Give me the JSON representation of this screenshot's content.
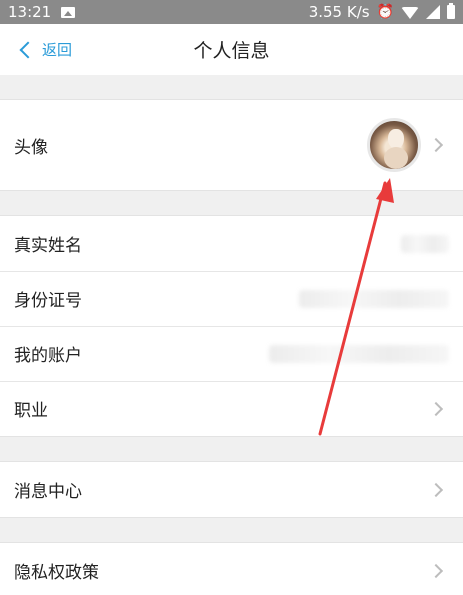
{
  "status_bar": {
    "time": "13:21",
    "network_speed": "3.55 K/s",
    "icons": [
      "image-icon",
      "alarm-icon",
      "wifi-icon",
      "signal-icon",
      "battery-icon"
    ]
  },
  "nav": {
    "back_label": "返回",
    "title": "个人信息"
  },
  "rows": {
    "avatar_label": "头像",
    "real_name_label": "真实姓名",
    "id_number_label": "身份证号",
    "account_label": "我的账户",
    "occupation_label": "职业",
    "message_center_label": "消息中心",
    "privacy_policy_label": "隐私权政策"
  },
  "colors": {
    "accent": "#2a9bd8",
    "annotation_arrow": "#e83b3b",
    "background": "#f0f0f0"
  }
}
